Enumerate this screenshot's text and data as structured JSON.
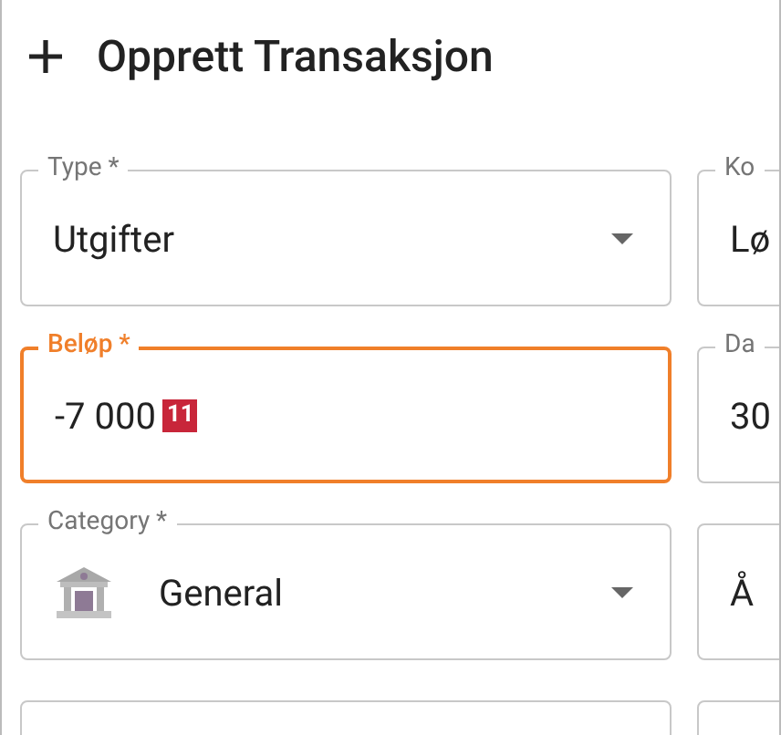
{
  "dialog": {
    "title": "Opprett Transaksjon"
  },
  "fields": [
    {
      "label": "Type *",
      "value": "Utgifter",
      "kind": "select",
      "focused": false
    },
    {
      "label": "Ko",
      "value": "Lø",
      "kind": "text",
      "focused": false
    },
    {
      "label": "Beløp *",
      "value": "-7 000",
      "badge": "11",
      "kind": "text",
      "focused": true
    },
    {
      "label": "Da",
      "value": "30",
      "kind": "text",
      "focused": false
    },
    {
      "label": "Category *",
      "value": "General",
      "kind": "select",
      "icon": true,
      "focused": false
    },
    {
      "value": "Å",
      "kind": "text",
      "focused": false
    },
    {
      "kind": "text",
      "focused": false
    },
    {
      "kind": "text",
      "focused": false
    }
  ]
}
